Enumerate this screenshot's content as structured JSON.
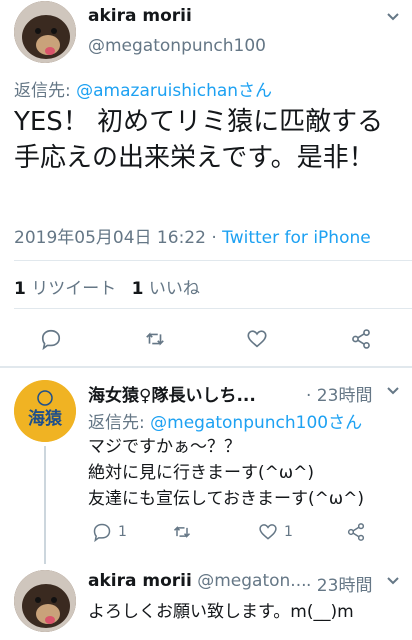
{
  "main_tweet": {
    "author_name": "akira morii",
    "author_handle": "@megatonpunch100",
    "reply_prefix": "返信先: ",
    "reply_to": "@amazaruishichanさん",
    "text": "YES！ 初めてリミ猿に匹敵する手応えの出来栄えです。是非！",
    "timestamp": "2019年05月04日 16:22",
    "separator": " · ",
    "source": "Twitter for iPhone",
    "retweet_count": "1",
    "retweet_label": "リツイート",
    "like_count": "1",
    "like_label": "いいね"
  },
  "reply1": {
    "author_name": "海女猿♀隊長いしち...",
    "time": "· 23時間",
    "reply_prefix": "返信先: ",
    "reply_to": "@megatonpunch100さん",
    "lines": [
      "マジですかぁ～？？",
      "絶対に見に行きまーす(^ω^)",
      "友達にも宣伝しておきまーす(^ω^)"
    ],
    "reply_count": "1",
    "like_count": "1",
    "logo_text": "海猿"
  },
  "reply2": {
    "author_name": "akira morii",
    "author_handle": "@megaton...",
    "time": "· 23時間",
    "text": "よろしくお願い致します。m(__)m"
  },
  "colors": {
    "accent": "#1da1f2",
    "muted": "#657786",
    "divider": "#e1e8ed",
    "logo_bg": "#f0b323"
  },
  "icons": [
    "reply-icon",
    "retweet-icon",
    "like-icon",
    "share-icon",
    "chevron-down-icon"
  ]
}
